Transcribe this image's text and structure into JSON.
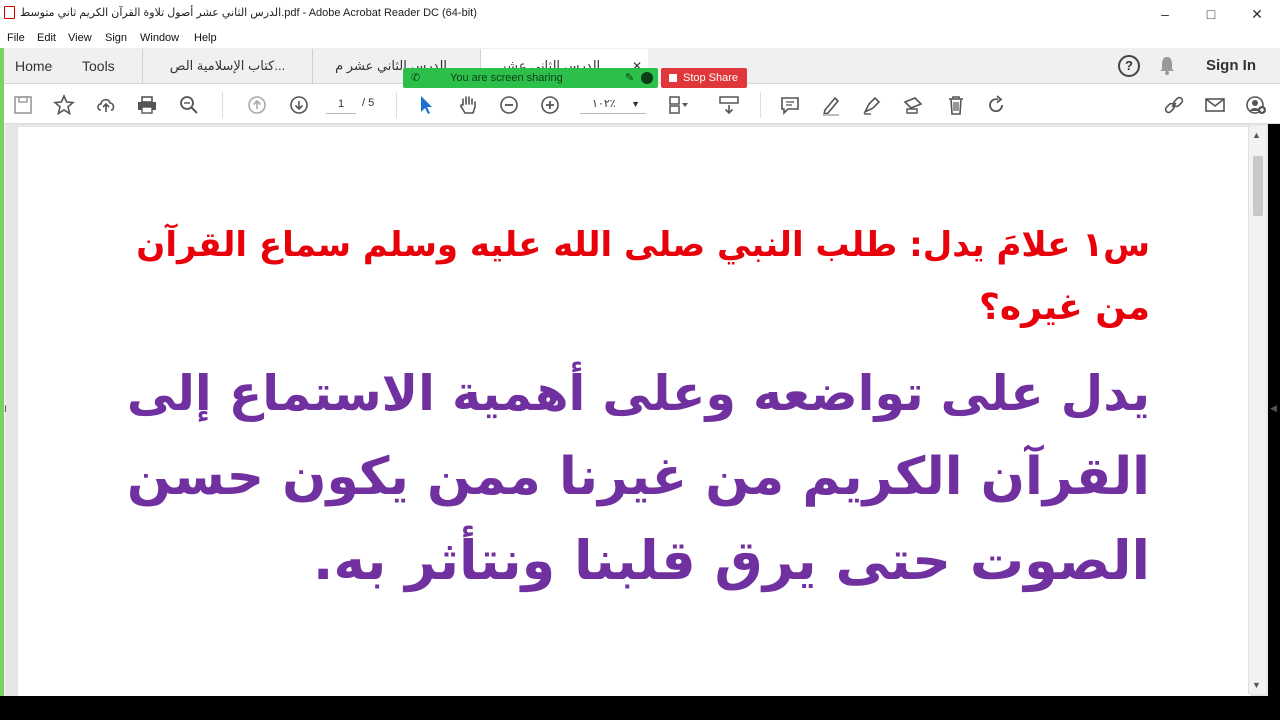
{
  "window": {
    "title": "الدرس الثاني عشر أصول تلاوة القرآن الكريم ثاني متوسط.pdf - Adobe Acrobat Reader DC (64-bit)",
    "minimize": "–",
    "maximize": "□",
    "close": "✕"
  },
  "menu": [
    "File",
    "Edit",
    "View",
    "Sign",
    "Window",
    "Help"
  ],
  "tabs": {
    "home": "Home",
    "tools": "Tools",
    "documents": [
      {
        "label": "كتاب الإسلامية الص..."
      },
      {
        "label": "الدرس الثاني عشر م..."
      },
      {
        "label": "الدرس الثاني عشر..."
      }
    ],
    "close_icon": "✕",
    "help_icon": "?",
    "signin": "Sign In"
  },
  "toolbar": {
    "page_current": "1",
    "page_total": "/ 5",
    "zoom": "١٠٢٪"
  },
  "screen_share": {
    "status": "You are screen sharing",
    "stop": "Stop Share"
  },
  "document": {
    "question_line1": "س١ علامَ يدل: طلب النبي صلى الله عليه وسلم سماع القرآن",
    "question_line2": "من غيره؟",
    "answer_line1": "يدل على تواضعه وعلى أهمية الاستماع إلى",
    "answer_line2": "القرآن الكريم من غيرنا ممن يكون حسن",
    "answer_line3": "الصوت حتى يرق قلبنا ونتأثر به."
  },
  "colors": {
    "question": "#e8000b",
    "answer": "#7030a0",
    "share_bar": "#2cc04b",
    "stop_button": "#e0383a"
  }
}
